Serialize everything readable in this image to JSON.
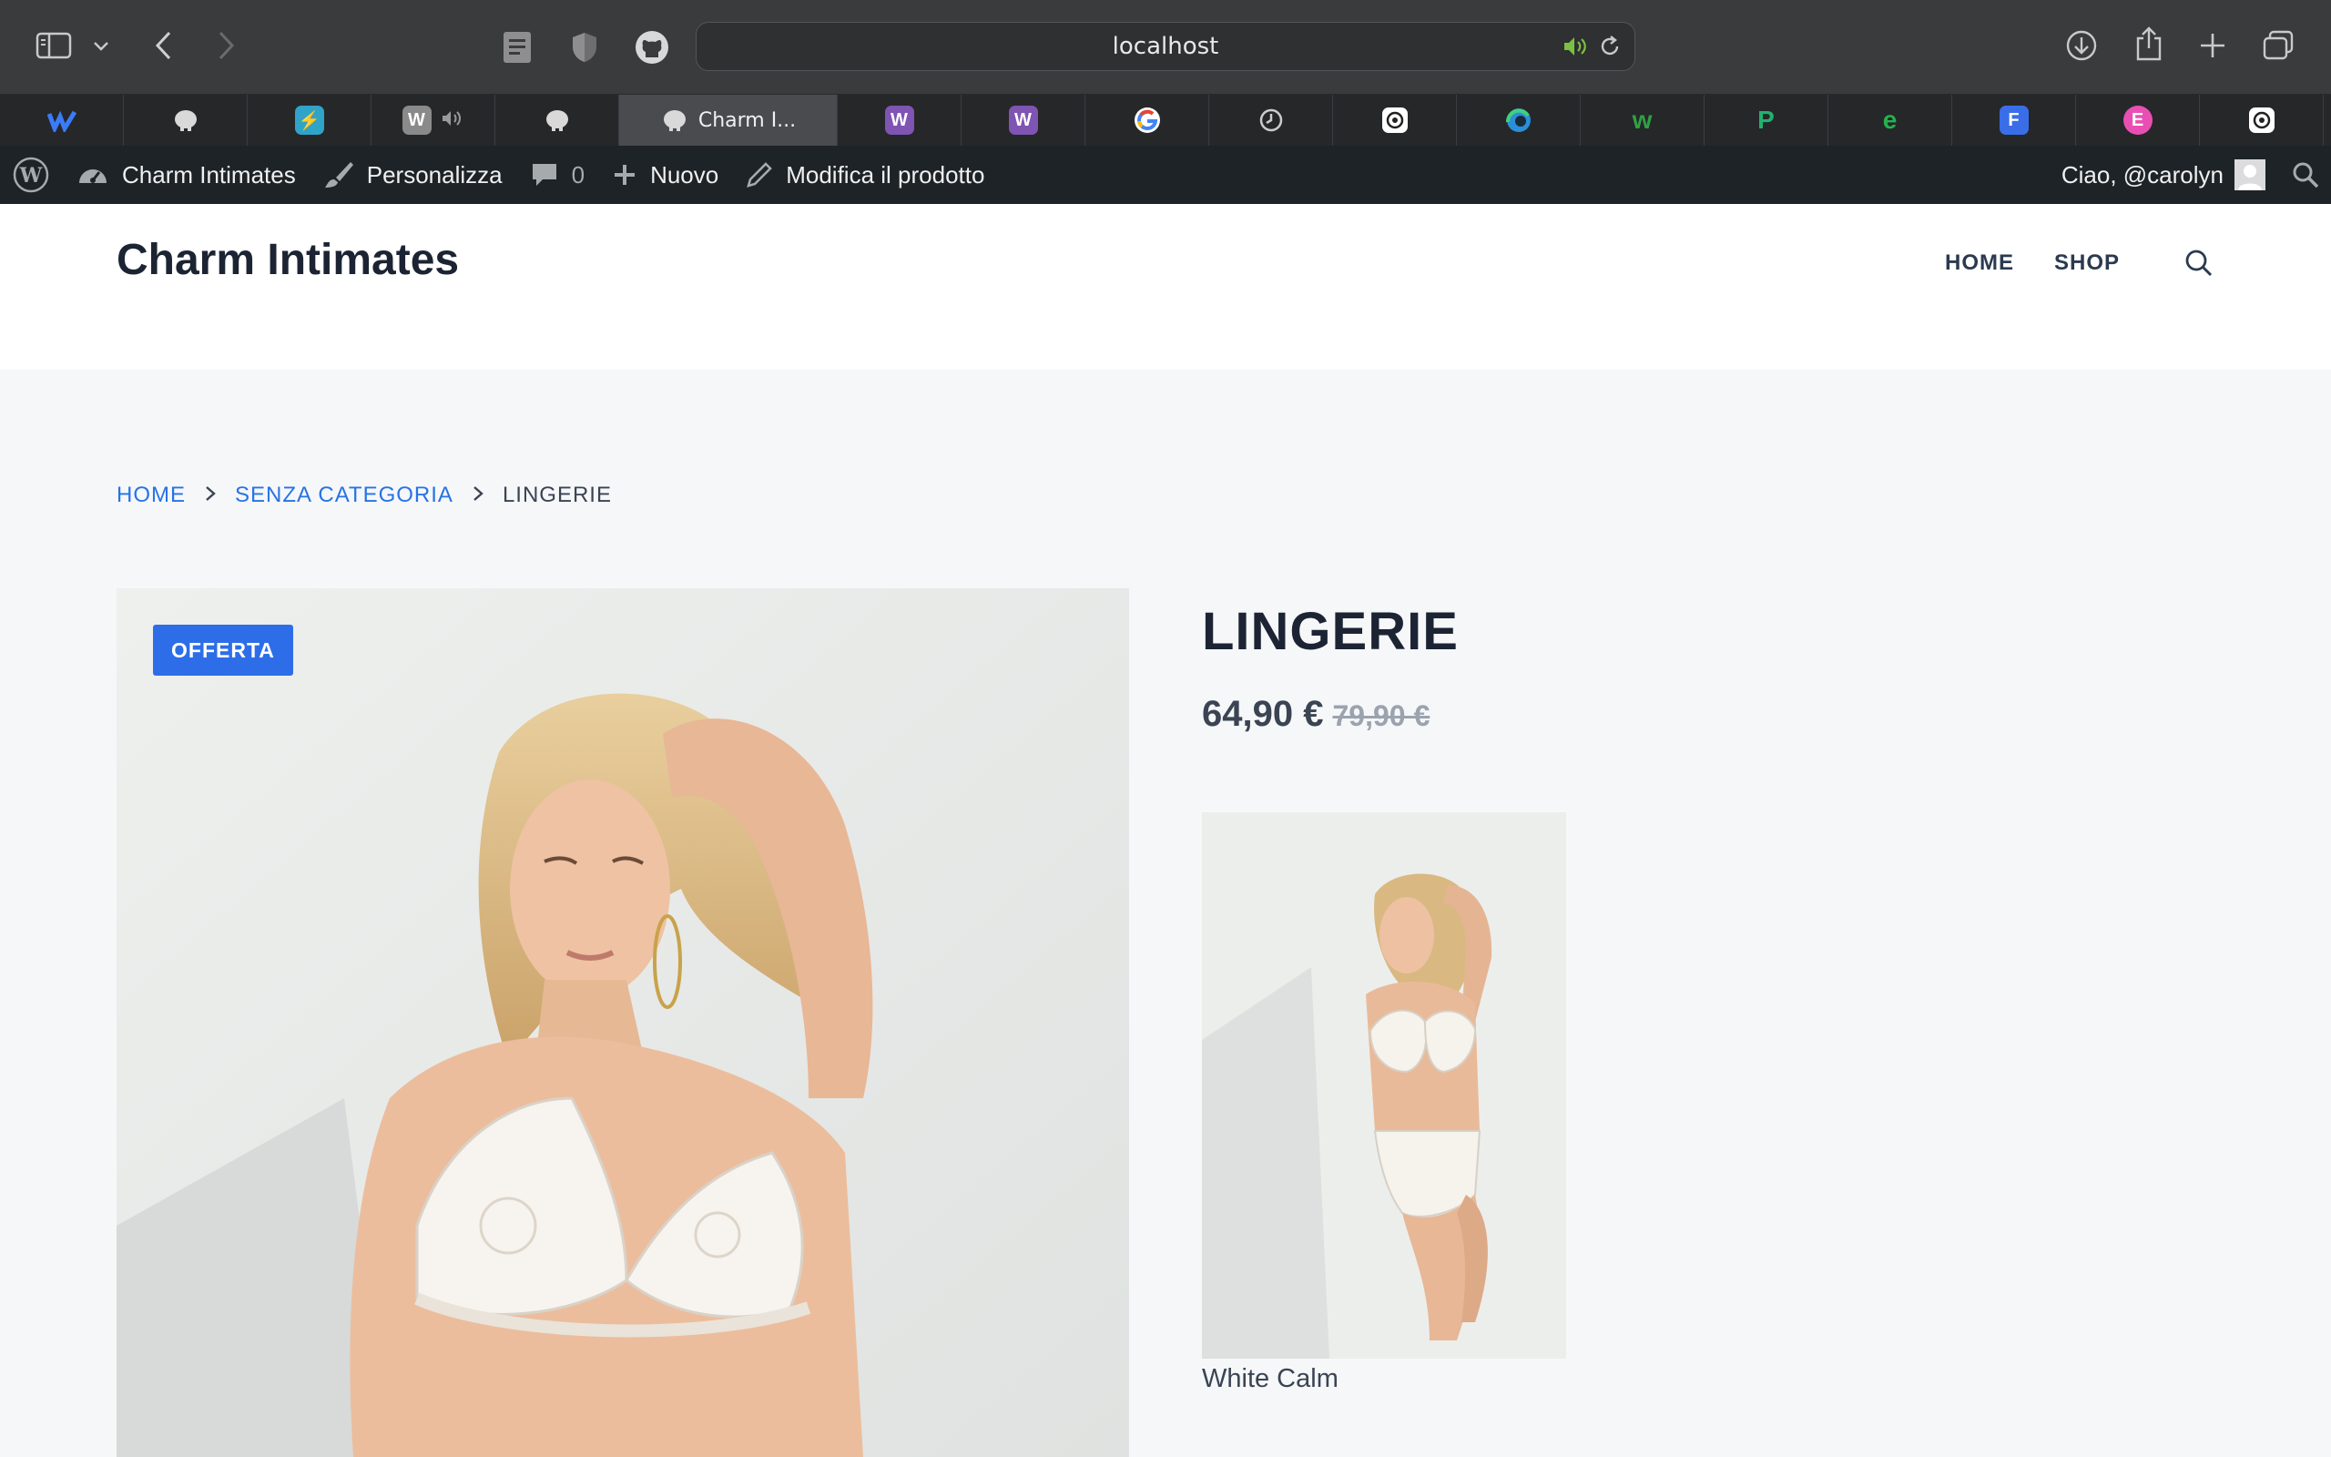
{
  "browser": {
    "url": "localhost",
    "tabs": [
      {
        "icon": "webflow-icon",
        "title": "",
        "color": "#3b7bf6"
      },
      {
        "icon": "elephant-icon",
        "title": "",
        "color": "#d9d9d9"
      },
      {
        "icon": "bolt-icon",
        "title": "",
        "color": "#30a3c8"
      },
      {
        "icon": "wordpress-w-icon",
        "title": "",
        "color": "#8a8a8a",
        "audio": true
      },
      {
        "icon": "elephant-icon",
        "title": "",
        "color": "#d9d9d9"
      },
      {
        "icon": "elephant-icon",
        "title": "Charm I...",
        "color": "#d9d9d9",
        "active": true
      },
      {
        "icon": "woo-w-icon",
        "title": "",
        "color": "#7f54b3"
      },
      {
        "icon": "woo-w-icon",
        "title": "",
        "color": "#7f54b3"
      },
      {
        "icon": "google-icon",
        "title": "",
        "color": "#ffffff"
      },
      {
        "icon": "clock-icon",
        "title": "",
        "color": "#cccccc"
      },
      {
        "icon": "openai-icon",
        "title": "",
        "color": "#ffffff"
      },
      {
        "icon": "edge-icon",
        "title": "",
        "color": "#2a8fd8"
      },
      {
        "icon": "w-brand-icon",
        "title": "",
        "color": "#2fa043"
      },
      {
        "icon": "p-brand-icon",
        "title": "",
        "color": "#21b26f"
      },
      {
        "icon": "e-brand-icon",
        "title": "",
        "color": "#24b24b"
      },
      {
        "icon": "f-brand-icon",
        "title": "",
        "color": "#3a6ee8"
      },
      {
        "icon": "elementor-icon",
        "title": "",
        "color": "#e94fb2"
      },
      {
        "icon": "openai-icon",
        "title": "",
        "color": "#ffffff"
      }
    ]
  },
  "adminbar": {
    "site_name": "Charm Intimates",
    "customize": "Personalizza",
    "comments_count": "0",
    "new": "Nuovo",
    "edit_product": "Modifica il prodotto",
    "greeting": "Ciao, @carolyn"
  },
  "site": {
    "title": "Charm Intimates",
    "nav": {
      "home": "HOME",
      "shop": "SHOP"
    }
  },
  "breadcrumb": {
    "home": "HOME",
    "category": "SENZA CATEGORIA",
    "current": "LINGERIE"
  },
  "product": {
    "badge": "OFFERTA",
    "title": "LINGERIE",
    "price_sale": "64,90 €",
    "price_regular": "79,90 €",
    "variation_label": "White Calm"
  },
  "colors": {
    "accent": "#2d6ee8",
    "link": "#2673e6",
    "adminbar": "#1d2327",
    "heading": "#1c2434"
  }
}
